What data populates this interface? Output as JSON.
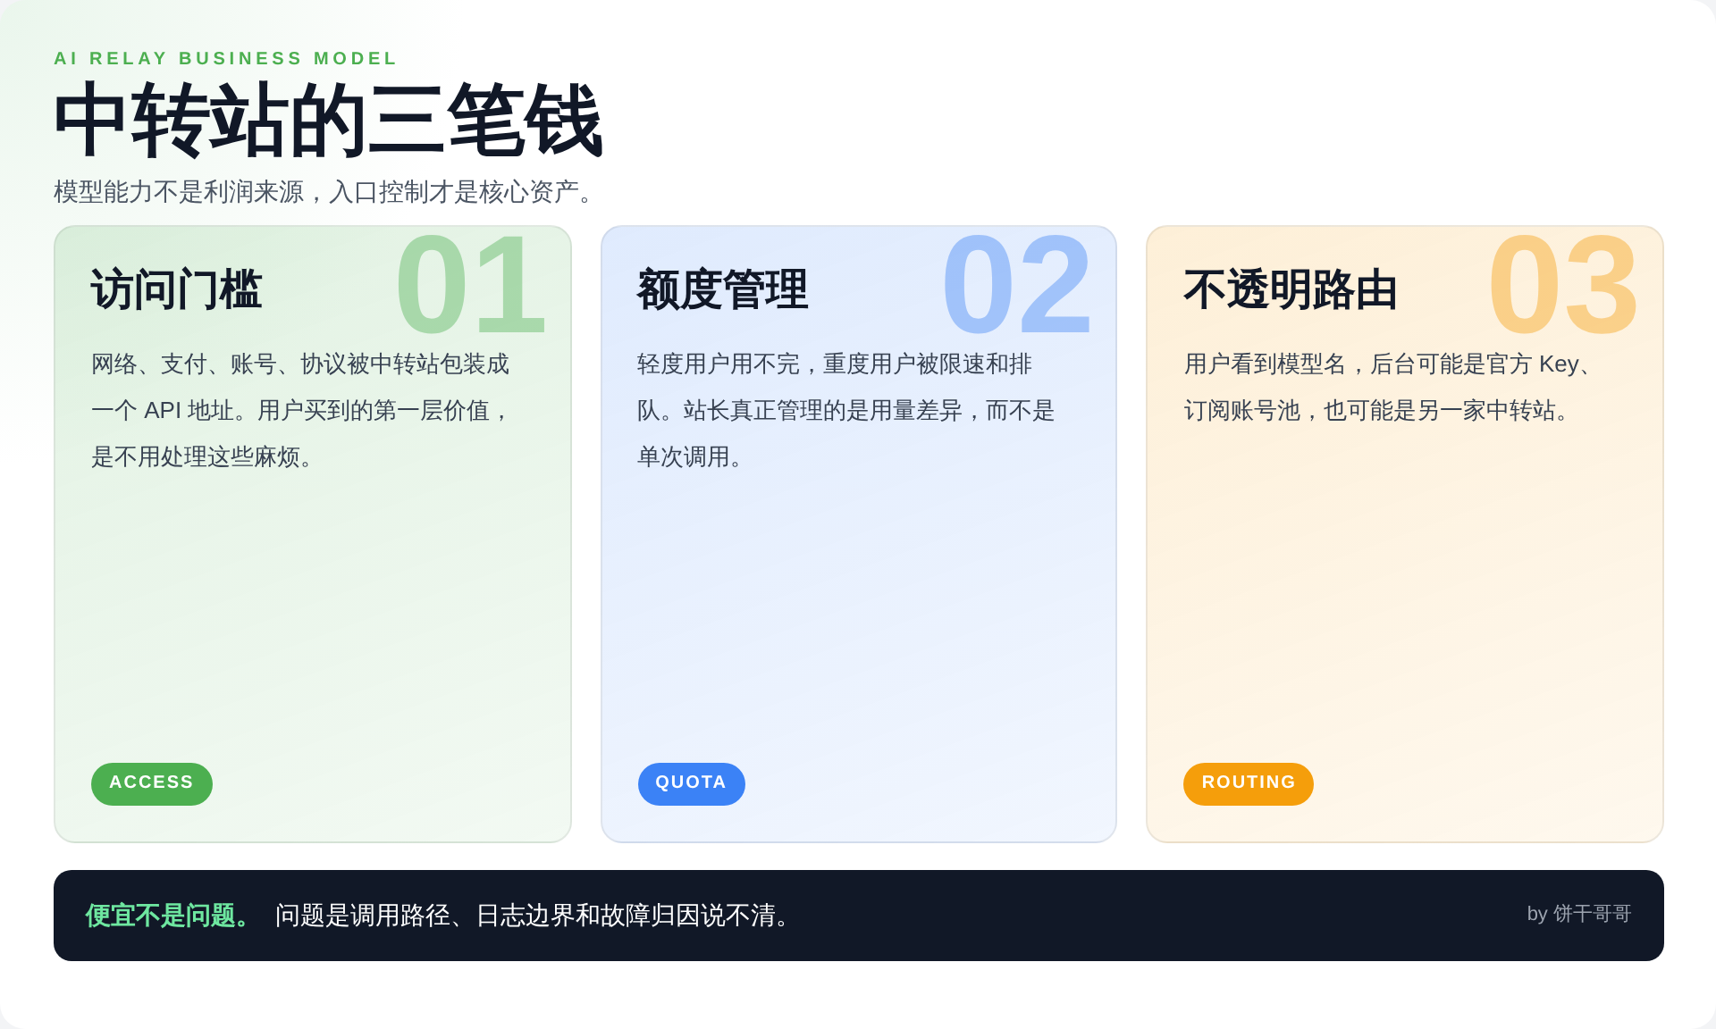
{
  "kicker": "AI RELAY BUSINESS MODEL",
  "title": "中转站的三笔钱",
  "subtitle": "模型能力不是利润来源，入口控制才是核心资产。",
  "cards": [
    {
      "number": "01",
      "title": "访问门槛",
      "body": "网络、支付、账号、协议被中转站包装成一个 API 地址。用户买到的第一层价值，是不用处理这些麻烦。",
      "tag": "ACCESS",
      "color": "#4caf50"
    },
    {
      "number": "02",
      "title": "额度管理",
      "body": "轻度用户用不完，重度用户被限速和排队。站长真正管理的是用量差异，而不是单次调用。",
      "tag": "QUOTA",
      "color": "#3b82f6"
    },
    {
      "number": "03",
      "title": "不透明路由",
      "body": "用户看到模型名，后台可能是官方 Key、订阅账号池，也可能是另一家中转站。",
      "tag": "ROUTING",
      "color": "#f59e0b"
    }
  ],
  "banner": {
    "lead": "便宜不是问题。",
    "text": "问题是调用路径、日志边界和故障归因说不清。",
    "byline": "by 饼干哥哥"
  }
}
